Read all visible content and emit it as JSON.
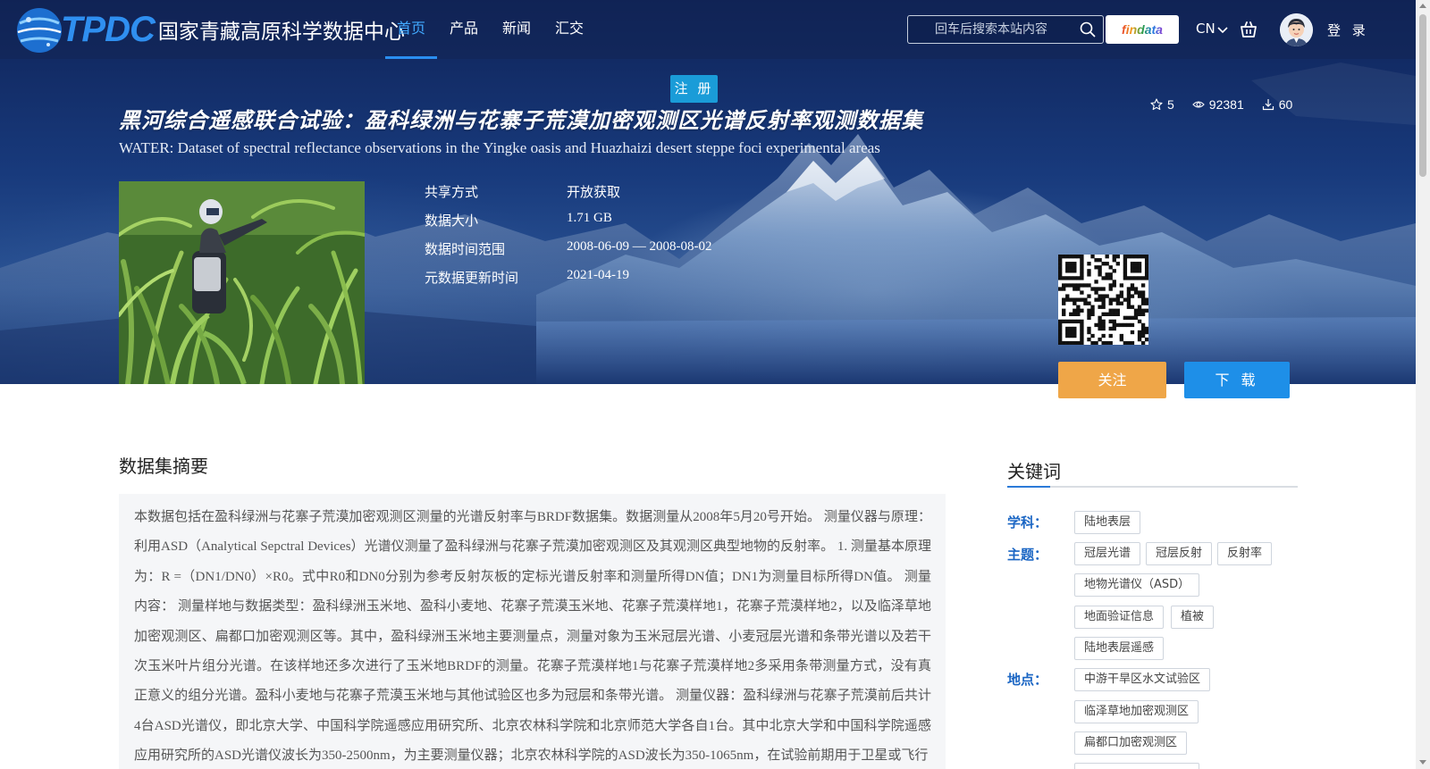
{
  "header": {
    "logo_abbr": "TPDC",
    "logo_text": "国家青藏高原科学数据中心",
    "nav": [
      {
        "label": "首页",
        "active": true
      },
      {
        "label": "产品",
        "active": false
      },
      {
        "label": "新闻",
        "active": false
      },
      {
        "label": "汇交",
        "active": false
      }
    ],
    "search_placeholder": "回车后搜索本站内容",
    "findata_label": "findata",
    "lang": "CN",
    "login": "登 录",
    "register": "注 册"
  },
  "dataset": {
    "title_cn": "黑河综合遥感联合试验：盈科绿洲与花寨子荒漠加密观测区光谱反射率观测数据集",
    "title_en": "WATER: Dataset of spectral reflectance observations in the Yingke oasis and Huazhaizi desert steppe foci experimental areas",
    "stats": {
      "stars": "5",
      "views": "92381",
      "downloads": "60"
    },
    "meta": [
      {
        "label": "共享方式",
        "value": "开放获取"
      },
      {
        "label": "数据大小",
        "value": "1.71 GB"
      },
      {
        "label": "数据时间范围",
        "value": "2008-06-09 — 2008-08-02"
      },
      {
        "label": "元数据更新时间",
        "value": "2021-04-19"
      }
    ],
    "follow_label": "关注",
    "download_label": "下 载"
  },
  "abstract": {
    "title": "数据集摘要",
    "text": "本数据包括在盈科绿洲与花寨子荒漠加密观测区测量的光谱反射率与BRDF数据集。数据测量从2008年5月20号开始。 测量仪器与原理：利用ASD（Analytical Sepctral Devices）光谱仪测量了盈科绿洲与花寨子荒漠加密观测区及其观测区典型地物的反射率。 1. 测量基本原理为：R =（DN1/DN0）×R0。式中R0和DN0分别为参考反射灰板的定标光谱反射率和测量所得DN值；DN1为测量目标所得DN值。 测量内容： 测量样地与数据类型：盈科绿洲玉米地、盈科小麦地、花寨子荒漠玉米地、花寨子荒漠样地1，花寨子荒漠样地2，以及临泽草地加密观测区、扁都口加密观测区等。其中，盈科绿洲玉米地主要测量点，测量对象为玉米冠层光谱、小麦冠层光谱和条带光谱以及若干次玉米叶片组分光谱。在该样地还多次进行了玉米地BRDF的测量。花寨子荒漠样地1与花寨子荒漠样地2多采用条带测量方式，没有真正意义的组分光谱。盈科小麦地与花寨子荒漠玉米地与其他试验区也多为冠层和条带光谱。 测量仪器：盈科绿洲与花寨子荒漠前后共计4台ASD光谱仪，即北京大学、中国科学院遥感应用研究所、北京农林科学院和北京师范大学各自1台。其中北京大学和中国科学院遥感应用研究所的ASD光谱仪波长为350-2500nm，为主要测量仪器；北京农林科学院的ASD波长为350-1065nm，在试验前期用于卫星或飞行"
  },
  "keywords": {
    "title": "关键词",
    "subject_label": "学科：",
    "subject": [
      "陆地表层"
    ],
    "theme_label": "主题：",
    "theme": [
      "冠层光谱",
      "冠层反射",
      "反射率",
      "地物光谱仪（ASD）",
      "地面验证信息",
      "植被",
      "陆地表层遥感"
    ],
    "place_label": "地点：",
    "place": [
      "中游干旱区水文试验区",
      "临泽草地加密观测区",
      "扁都口加密观测区"
    ]
  },
  "colors": {
    "nav_active": "#41a9ff",
    "register": "#1a9cd8",
    "follow": "#efa648",
    "download": "#1e8fe8",
    "keyword_label": "#1b66c4"
  }
}
